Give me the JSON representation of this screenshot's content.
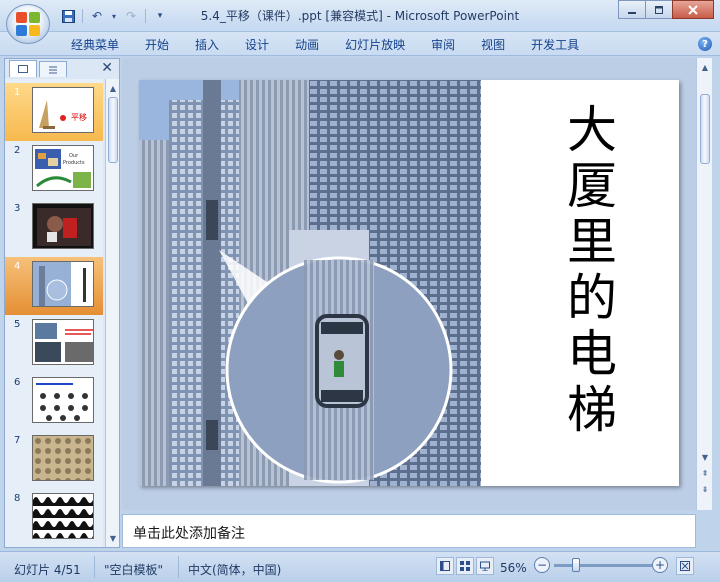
{
  "window": {
    "title": "5.4_平移（课件）.ppt [兼容模式] - Microsoft PowerPoint",
    "minimize_icon": "minimize-icon",
    "maximize_icon": "restore-icon",
    "close_icon": "close-icon"
  },
  "quick_access": [
    "save-icon",
    "undo-icon",
    "redo-icon",
    "customize-icon"
  ],
  "ribbon": {
    "tabs": [
      "经典菜单",
      "开始",
      "插入",
      "设计",
      "动画",
      "幻灯片放映",
      "审阅",
      "视图",
      "开发工具"
    ]
  },
  "slide_panel": {
    "tabs": [
      "slides-tab-icon",
      "outline-tab-icon"
    ],
    "slides": [
      {
        "num": "1",
        "state": "selected"
      },
      {
        "num": "2",
        "state": "normal"
      },
      {
        "num": "3",
        "state": "normal"
      },
      {
        "num": "4",
        "state": "active"
      },
      {
        "num": "5",
        "state": "normal"
      },
      {
        "num": "6",
        "state": "normal"
      },
      {
        "num": "7",
        "state": "normal"
      },
      {
        "num": "8",
        "state": "normal"
      }
    ],
    "thumb_texts": {
      "slide1": "平移",
      "slide2_line1": "Our",
      "slide2_line2": "Products"
    }
  },
  "slide": {
    "vertical_text": [
      "大",
      "厦",
      "里",
      "的",
      "电",
      "梯"
    ]
  },
  "notes": {
    "placeholder": "单击此处添加备注"
  },
  "status": {
    "slide_info": "幻灯片 4/51",
    "template": "\"空白模板\"",
    "language": "中文(简体，中国)",
    "zoom": "56%"
  },
  "colors": {
    "accent": "#15428b",
    "selected_thumb": "#f7b94e",
    "active_thumb": "#e58f34"
  }
}
